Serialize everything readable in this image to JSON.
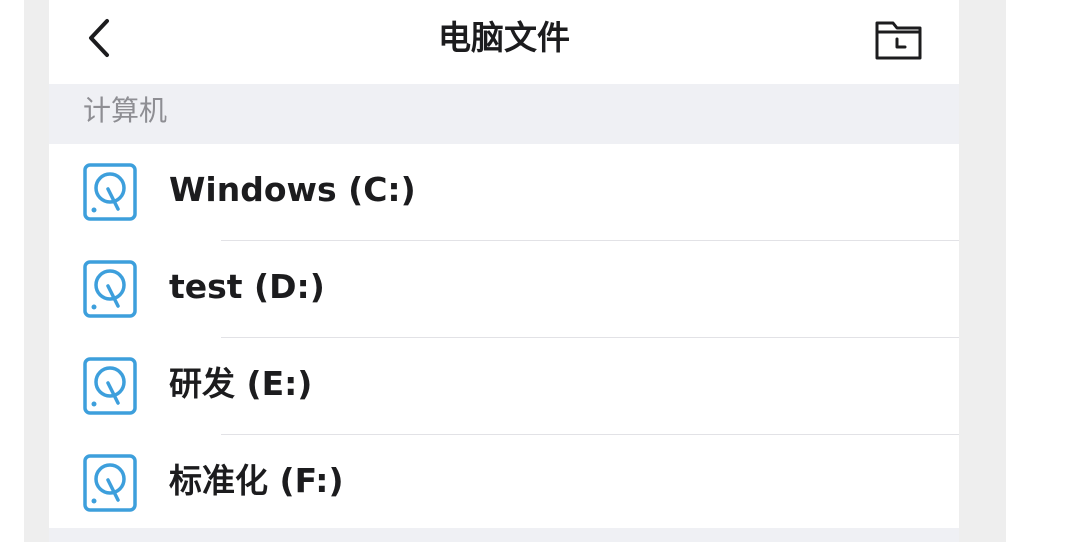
{
  "header": {
    "title": "电脑文件",
    "back_icon": "chevron-left-icon",
    "folder_icon": "folder-history-icon"
  },
  "section": {
    "label": "计算机"
  },
  "drives": [
    {
      "label": "Windows (C:)",
      "icon": "hard-drive-icon"
    },
    {
      "label": "test (D:)",
      "icon": "hard-drive-icon"
    },
    {
      "label": "研发 (E:)",
      "icon": "hard-drive-icon"
    },
    {
      "label": "标准化 (F:)",
      "icon": "hard-drive-icon"
    }
  ],
  "colors": {
    "accent": "#3d9fdc",
    "section_bg": "#eff0f4",
    "section_text": "#8e8e93",
    "text": "#1c1c1e",
    "gutter": "#eeeeee"
  }
}
